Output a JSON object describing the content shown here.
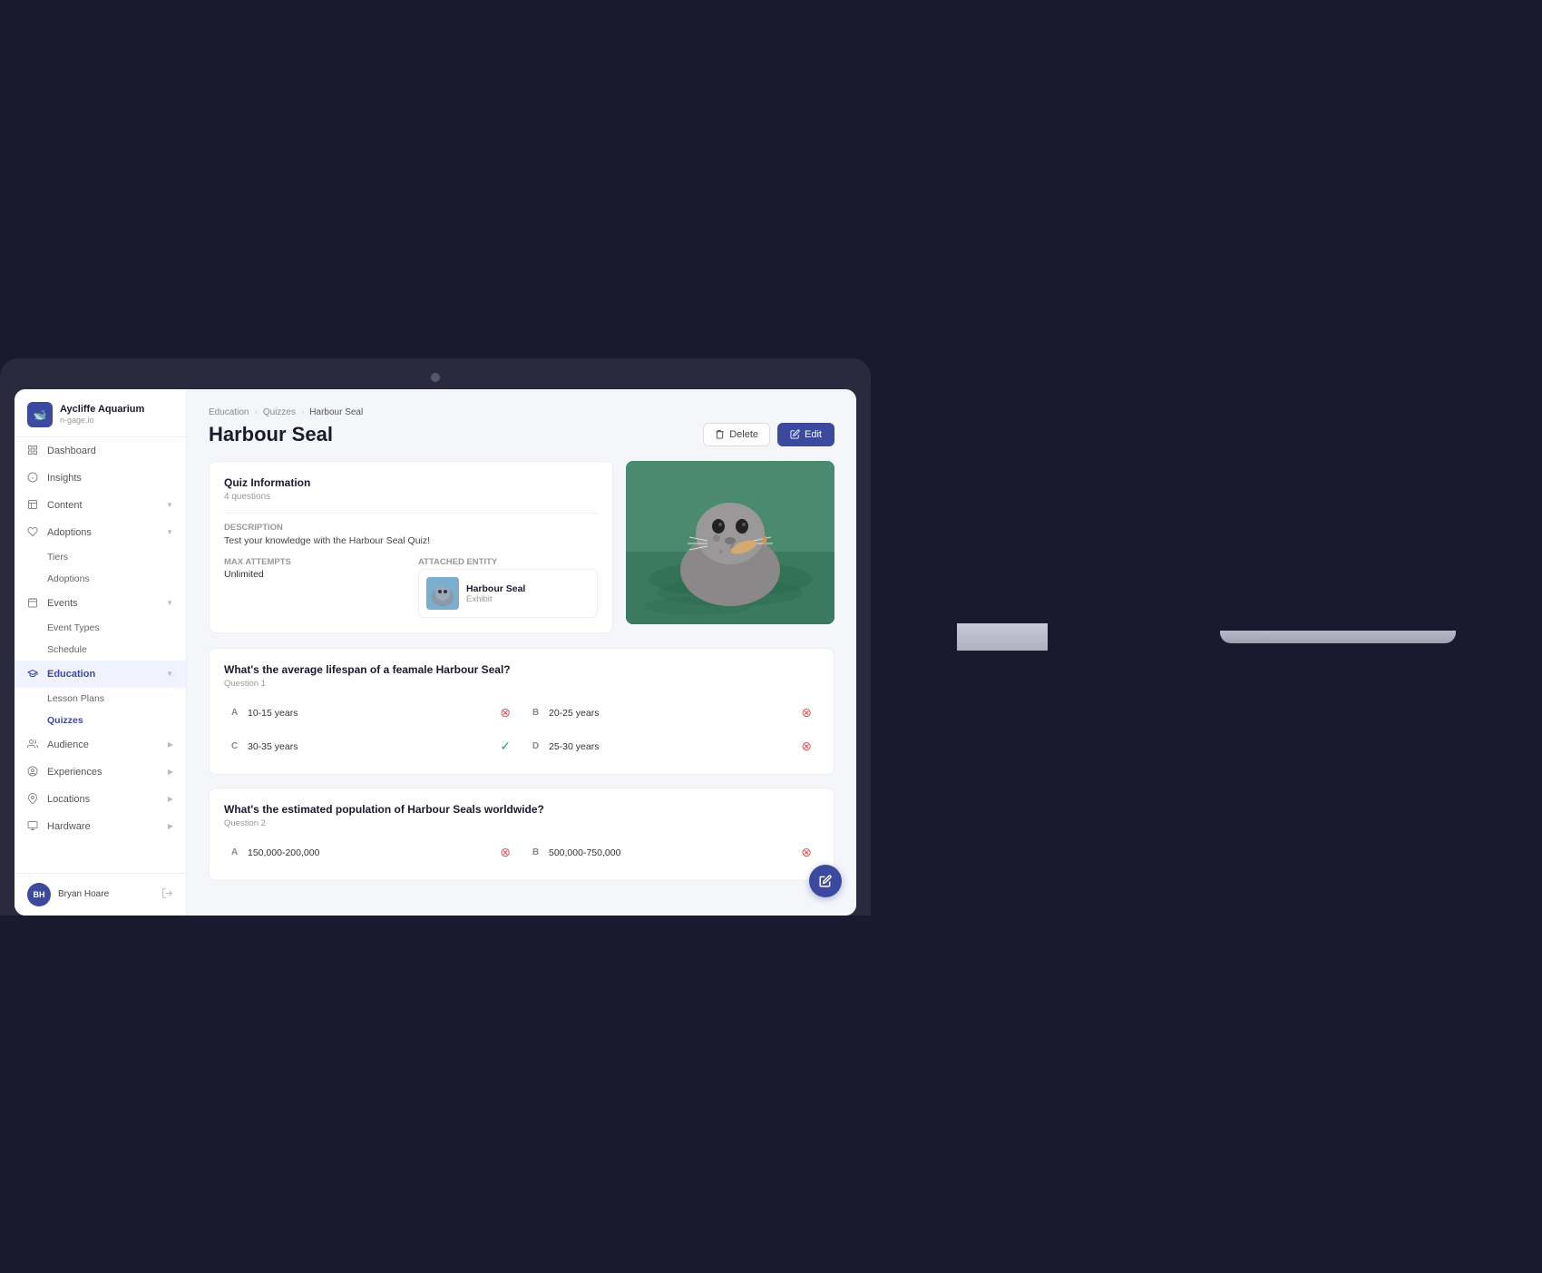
{
  "monitor": {
    "camera_label": "camera"
  },
  "app": {
    "logo": {
      "icon": "🐋",
      "title": "Aycliffe Aquarium",
      "subtitle": "n-gage.io"
    }
  },
  "sidebar": {
    "nav_items": [
      {
        "id": "dashboard",
        "label": "Dashboard",
        "icon": "⌂",
        "active": false
      },
      {
        "id": "insights",
        "label": "Insights",
        "icon": "📊",
        "active": false
      },
      {
        "id": "content",
        "label": "Content",
        "icon": "⊞",
        "active": false,
        "has_chevron": true
      },
      {
        "id": "adoptions",
        "label": "Adoptions",
        "icon": "♥",
        "active": false,
        "has_chevron": true
      },
      {
        "id": "events",
        "label": "Events",
        "icon": "📅",
        "active": false,
        "has_chevron": true
      },
      {
        "id": "education",
        "label": "Education",
        "icon": "🎓",
        "active": true,
        "has_chevron": true
      },
      {
        "id": "audience",
        "label": "Audience",
        "icon": "👥",
        "active": false,
        "has_chevron": true
      },
      {
        "id": "experiences",
        "label": "Experiences",
        "icon": "📷",
        "active": false,
        "has_chevron": true
      },
      {
        "id": "locations",
        "label": "Locations",
        "icon": "📍",
        "active": false,
        "has_chevron": true
      },
      {
        "id": "hardware",
        "label": "Hardware",
        "icon": "💻",
        "active": false,
        "has_chevron": true
      }
    ],
    "sub_items": {
      "adoptions": [
        "Tiers",
        "Adoptions"
      ],
      "events": [
        "Event Types",
        "Schedule"
      ],
      "education": [
        "Lesson Plans",
        "Quizzes"
      ]
    },
    "active_sub": "Quizzes",
    "footer": {
      "initials": "BH",
      "name": "Bryan Hoare",
      "logout_icon": "→"
    }
  },
  "breadcrumb": {
    "items": [
      "Education",
      "Quizzes",
      "Harbour Seal"
    ]
  },
  "page": {
    "title": "Harbour Seal",
    "delete_button": "Delete",
    "edit_button": "Edit"
  },
  "quiz_info": {
    "card_title": "Quiz Information",
    "questions_count": "4 questions",
    "description_label": "Description",
    "description_text": "Test your knowledge with the Harbour Seal Quiz!",
    "max_attempts_label": "Max Attempts",
    "max_attempts_value": "Unlimited",
    "attached_entity_label": "Attached Entity",
    "entity_name": "Harbour Seal",
    "entity_type": "Exhibit"
  },
  "questions": [
    {
      "text": "What's the average lifespan of a feamale Harbour Seal?",
      "label": "Question 1",
      "options": [
        {
          "letter": "A",
          "text": "10-15 years",
          "correct": false
        },
        {
          "letter": "B",
          "text": "20-25 years",
          "correct": false
        },
        {
          "letter": "C",
          "text": "30-35 years",
          "correct": true
        },
        {
          "letter": "D",
          "text": "25-30 years",
          "correct": false
        }
      ]
    },
    {
      "text": "What's the estimated population of Harbour Seals worldwide?",
      "label": "Question 2",
      "options": [
        {
          "letter": "A",
          "text": "150,000-200,000",
          "correct": false
        },
        {
          "letter": "B",
          "text": "500,000-750,000",
          "correct": false
        }
      ]
    }
  ],
  "fab": {
    "icon": "✏",
    "label": "Edit FAB"
  }
}
